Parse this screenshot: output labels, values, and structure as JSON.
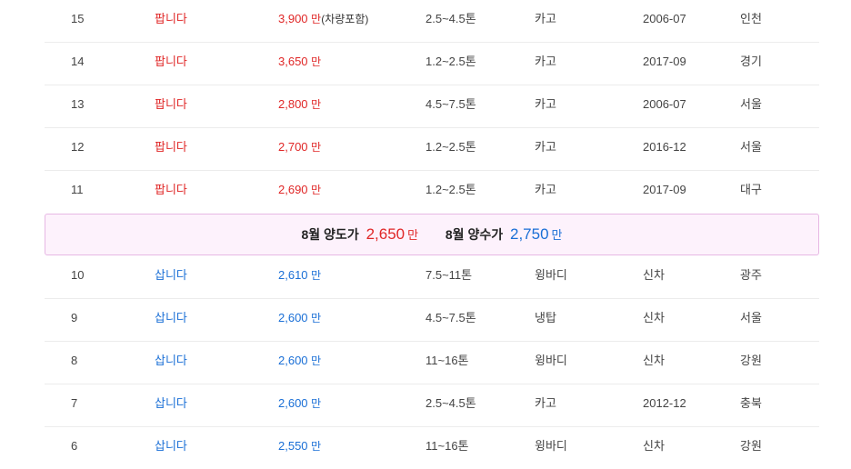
{
  "listings_top": [
    {
      "no": "15",
      "type": "팝니다",
      "price": "3,900",
      "unit": "만",
      "note": "(차량포함)",
      "tonnage": "2.5~4.5톤",
      "body": "카고",
      "year": "2006-07",
      "region": "인천"
    },
    {
      "no": "14",
      "type": "팝니다",
      "price": "3,650",
      "unit": "만",
      "note": "",
      "tonnage": "1.2~2.5톤",
      "body": "카고",
      "year": "2017-09",
      "region": "경기"
    },
    {
      "no": "13",
      "type": "팝니다",
      "price": "2,800",
      "unit": "만",
      "note": "",
      "tonnage": "4.5~7.5톤",
      "body": "카고",
      "year": "2006-07",
      "region": "서울"
    },
    {
      "no": "12",
      "type": "팝니다",
      "price": "2,700",
      "unit": "만",
      "note": "",
      "tonnage": "1.2~2.5톤",
      "body": "카고",
      "year": "2016-12",
      "region": "서울"
    },
    {
      "no": "11",
      "type": "팝니다",
      "price": "2,690",
      "unit": "만",
      "note": "",
      "tonnage": "1.2~2.5톤",
      "body": "카고",
      "year": "2017-09",
      "region": "대구"
    }
  ],
  "summary": {
    "sell_label": "8월 양도가",
    "sell_value": "2,650",
    "sell_unit": "만",
    "buy_label": "8월 양수가",
    "buy_value": "2,750",
    "buy_unit": "만"
  },
  "listings_bottom": [
    {
      "no": "10",
      "type": "삽니다",
      "price": "2,610",
      "unit": "만",
      "tonnage": "7.5~11톤",
      "body": "윙바디",
      "year": "신차",
      "region": "광주"
    },
    {
      "no": "9",
      "type": "삽니다",
      "price": "2,600",
      "unit": "만",
      "tonnage": "4.5~7.5톤",
      "body": "냉탑",
      "year": "신차",
      "region": "서울"
    },
    {
      "no": "8",
      "type": "삽니다",
      "price": "2,600",
      "unit": "만",
      "tonnage": "11~16톤",
      "body": "윙바디",
      "year": "신차",
      "region": "강원"
    },
    {
      "no": "7",
      "type": "삽니다",
      "price": "2,600",
      "unit": "만",
      "tonnage": "2.5~4.5톤",
      "body": "카고",
      "year": "2012-12",
      "region": "충북"
    },
    {
      "no": "6",
      "type": "삽니다",
      "price": "2,550",
      "unit": "만",
      "tonnage": "11~16톤",
      "body": "윙바디",
      "year": "신차",
      "region": "강원"
    }
  ],
  "colors": {
    "sell": "#e02727",
    "buy": "#1a6fd6",
    "summary_bg": "#fdf2fc",
    "summary_border": "#e7b7e4"
  }
}
